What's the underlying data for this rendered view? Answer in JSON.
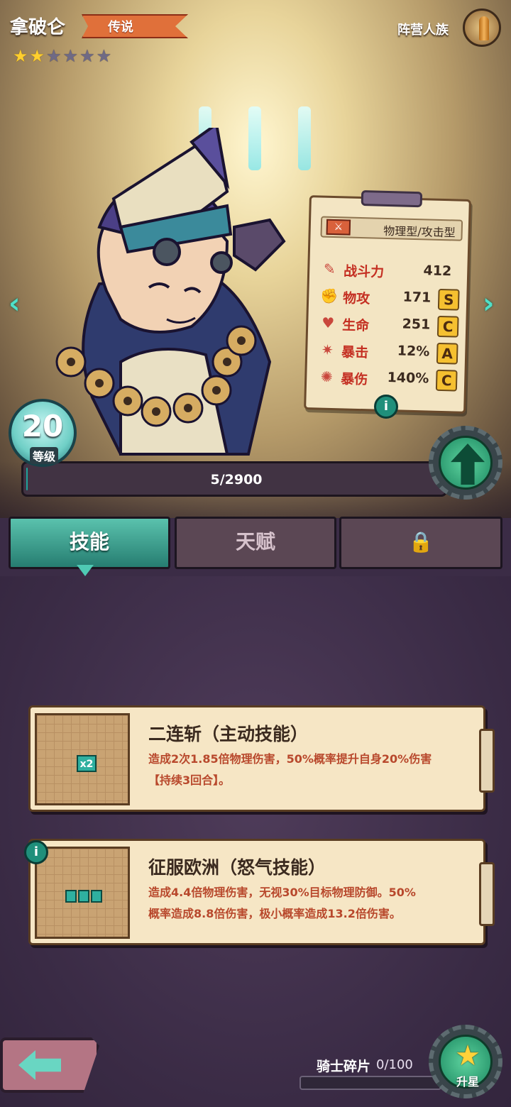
{
  "hero": {
    "name": "拿破仑",
    "rarity": "传说",
    "stars_total": 6,
    "stars_filled": 2,
    "faction_label": "阵营人族",
    "level": "20",
    "level_label": "等级",
    "exp": "5/2900",
    "exp_fraction": 0.0017
  },
  "stats": {
    "type": "物理型/攻击型",
    "rows": [
      {
        "icon": "power-icon",
        "label": "战斗力",
        "value": "412",
        "grade": ""
      },
      {
        "icon": "attack-icon",
        "label": "物攻",
        "value": "171",
        "grade": "S"
      },
      {
        "icon": "heart-icon",
        "label": "生命",
        "value": "251",
        "grade": "C"
      },
      {
        "icon": "crit-icon",
        "label": "暴击",
        "value": "12%",
        "grade": "A"
      },
      {
        "icon": "crit-damage-icon",
        "label": "暴伤",
        "value": "140%",
        "grade": "C"
      }
    ],
    "info": "i"
  },
  "tabs": {
    "skills": "技能",
    "talent": "天赋",
    "locked_icon": "lock-icon"
  },
  "skills": [
    {
      "title": "二连斩（主动技能）",
      "desc_line1": "造成2次1.85倍物理伤害，50%概率提升自身20%伤害",
      "desc_line2": "【持续3回合】。",
      "badge": "x2"
    },
    {
      "title": "征服欧洲（怒气技能）",
      "desc_line1": "造成4.4倍物理伤害，无视30%目标物理防御。50%",
      "desc_line2": "概率造成8.8倍伤害，极小概率造成13.2倍伤害。",
      "info": "i"
    }
  ],
  "bottom": {
    "fragments_label": "骑士碎片",
    "fragments_value": "0/100",
    "star_up_label": "升星"
  },
  "colors": {
    "accent_teal": "#1fa39a",
    "legend_orange": "#e0703a",
    "stat_red": "#c42f22",
    "grade_gold": "#f5c030"
  }
}
